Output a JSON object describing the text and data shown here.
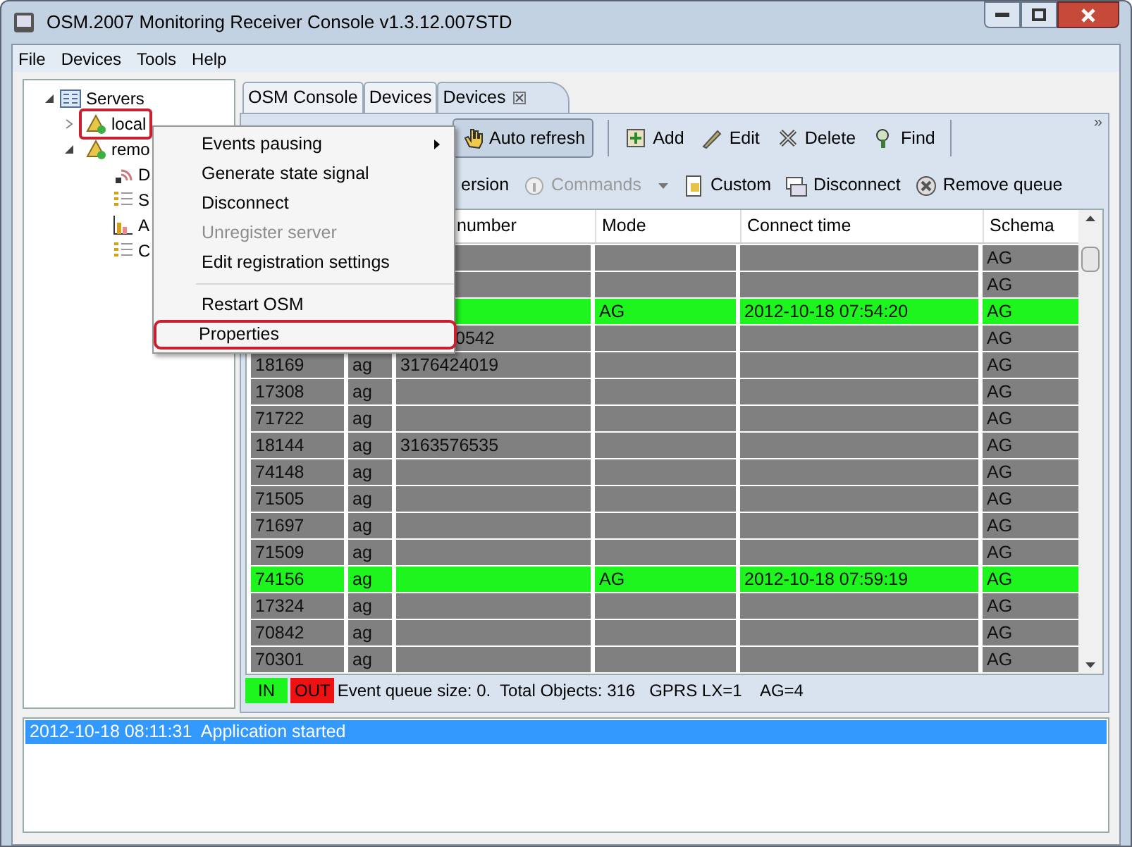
{
  "window": {
    "title": "OSM.2007 Monitoring Receiver Console v1.3.12.007STD"
  },
  "menu_bar": [
    "File",
    "Devices",
    "Tools",
    "Help"
  ],
  "tree": {
    "label": "Servers",
    "expanded": true,
    "children": [
      {
        "label": "local",
        "expanded": false,
        "annotated": true
      },
      {
        "label": "remo",
        "expanded": true,
        "annotated": false,
        "children": [
          {
            "label": "D"
          },
          {
            "label": "S"
          },
          {
            "label": "A"
          },
          {
            "label": "C"
          }
        ]
      }
    ]
  },
  "tabs": [
    {
      "label": "OSM Console",
      "selected": false,
      "closable": false
    },
    {
      "label": "Devices",
      "selected": false,
      "closable": false
    },
    {
      "label": "Devices",
      "selected": true,
      "closable": true
    }
  ],
  "toolbar_1": [
    {
      "label": "Auto refresh",
      "pressed": true
    },
    {
      "label": "Add",
      "pressed": false
    },
    {
      "label": "Edit",
      "pressed": false
    },
    {
      "label": "Delete",
      "pressed": false
    },
    {
      "label": "Find",
      "pressed": false
    }
  ],
  "toolbar_1_overflow": "»",
  "toolbar_2": [
    {
      "label": "ersion",
      "disabled": false,
      "dropdown": false
    },
    {
      "label": "Commands",
      "disabled": true,
      "dropdown": true
    },
    {
      "label": "Custom",
      "disabled": false,
      "dropdown": false
    },
    {
      "label": "Disconnect",
      "disabled": false,
      "dropdown": false
    },
    {
      "label": "Remove queue",
      "disabled": false,
      "dropdown": false
    }
  ],
  "table": {
    "columns": [
      "number",
      "Mode",
      "Connect time",
      "Schema"
    ],
    "rows": [
      {
        "online": false,
        "schema": "AG"
      },
      {
        "online": false,
        "schema": "AG"
      },
      {
        "online": true,
        "mode": "AG",
        "connect_time": "2012-10-18 07:54:20",
        "schema": "AG"
      },
      {
        "online": false,
        "phone": "0542",
        "covered": true,
        "schema": "AG"
      },
      {
        "online": false,
        "id": "18169",
        "type": "ag",
        "phone": "3176424019",
        "schema": "AG"
      },
      {
        "online": false,
        "id": "17308",
        "type": "ag",
        "schema": "AG"
      },
      {
        "online": false,
        "id": "71722",
        "type": "ag",
        "schema": "AG"
      },
      {
        "online": false,
        "id": "18144",
        "type": "ag",
        "phone": "3163576535",
        "schema": "AG"
      },
      {
        "online": false,
        "id": "74148",
        "type": "ag",
        "schema": "AG"
      },
      {
        "online": false,
        "id": "71505",
        "type": "ag",
        "schema": "AG"
      },
      {
        "online": false,
        "id": "71697",
        "type": "ag",
        "schema": "AG"
      },
      {
        "online": false,
        "id": "71509",
        "type": "ag",
        "schema": "AG"
      },
      {
        "online": true,
        "id": "74156",
        "type": "ag",
        "mode": "AG",
        "connect_time": "2012-10-18 07:59:19",
        "schema": "AG"
      },
      {
        "online": false,
        "id": "17324",
        "type": "ag",
        "schema": "AG"
      },
      {
        "online": false,
        "id": "70842",
        "type": "ag",
        "schema": "AG"
      },
      {
        "online": false,
        "id": "70301",
        "type": "ag",
        "schema": "AG"
      }
    ]
  },
  "status_bar": {
    "in": "IN",
    "out": "OUT",
    "text": "Event queue size: 0.  Total Objects: 316   GPRS LX=1    AG=4"
  },
  "log": [
    {
      "text": "2012-10-18 08:11:31  Application started",
      "selected": true
    }
  ],
  "context_menu": [
    {
      "label": "Events pausing",
      "submenu": true,
      "disabled": false,
      "annotated": false
    },
    {
      "label": "Generate state signal",
      "submenu": false,
      "disabled": false,
      "annotated": false
    },
    {
      "label": "Disconnect",
      "submenu": false,
      "disabled": false,
      "annotated": false
    },
    {
      "label": "Unregister server",
      "submenu": false,
      "disabled": true,
      "annotated": false
    },
    {
      "label": "Edit registration settings",
      "submenu": false,
      "disabled": false,
      "annotated": false
    },
    {
      "kind": "separator"
    },
    {
      "label": "Restart OSM",
      "submenu": false,
      "disabled": false,
      "annotated": false
    },
    {
      "label": "Properties",
      "submenu": false,
      "disabled": false,
      "annotated": true
    }
  ]
}
